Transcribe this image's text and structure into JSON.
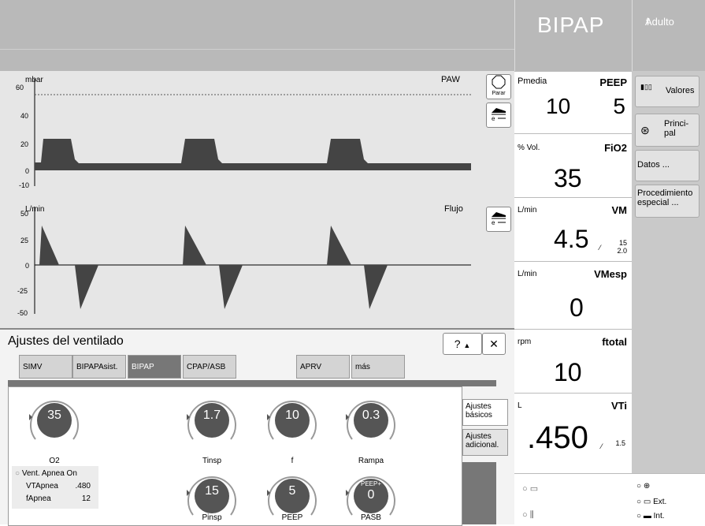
{
  "header": {
    "mode": "BIPAP",
    "patient_icon": "person-icon",
    "patient": "Adulto"
  },
  "curves": {
    "paw": {
      "unit": "mbar",
      "label": "PAW",
      "ticks": [
        "60",
        "40",
        "20",
        "0",
        "-10"
      ]
    },
    "flow": {
      "unit": "L/min",
      "label": "Flujo",
      "ticks": [
        "50",
        "25",
        "0",
        "-25",
        "-50"
      ]
    },
    "stop_label": "Parar"
  },
  "params": {
    "pmedia": {
      "label": "Pmedia",
      "value": "10"
    },
    "peep": {
      "label": "PEEP",
      "value": "5"
    },
    "fio2": {
      "unit": "% Vol.",
      "label": "FiO2",
      "value": "35"
    },
    "vm": {
      "unit": "L/min",
      "label": "VM",
      "value": "4.5",
      "alarm_hi": "15",
      "alarm_lo": "2.0"
    },
    "vmesp": {
      "unit": "L/min",
      "label": "VMesp",
      "value": "0"
    },
    "ftotal": {
      "unit": "rpm",
      "label": "ftotal",
      "value": "10"
    },
    "vti": {
      "unit": "L",
      "label": "VTi",
      "value": ".450",
      "alarm": "1.5"
    }
  },
  "right": {
    "valores": "Valores",
    "principal": "Princi- pal",
    "datos": "Datos ...",
    "procedimiento": "Procedimiento especial ...",
    "ext": "Ext.",
    "int": "Int."
  },
  "dialog": {
    "title": "Ajustes del ventilado",
    "help": "?",
    "collapse": "▲",
    "close": "✕",
    "tabs": [
      "SIMV",
      "BIPAPAsist.",
      "BIPAP",
      "CPAP/ASB",
      "APRV",
      "más"
    ],
    "side_tabs": [
      "Ajustes básicos",
      "Ajustes adicional."
    ],
    "knobs": {
      "o2": {
        "value": "35",
        "label": "O2"
      },
      "tinsp": {
        "value": "1.7",
        "label": "Tinsp"
      },
      "f": {
        "value": "10",
        "label": "f"
      },
      "rampa": {
        "value": "0.3",
        "label": "Rampa"
      },
      "pinsp": {
        "value": "15",
        "label": "Pinsp"
      },
      "peep": {
        "value": "5",
        "label": "PEEP"
      },
      "pasb": {
        "top": "PEEP+",
        "value": "0",
        "label": "PASB"
      }
    },
    "apnea": {
      "title": "Vent. Apnea On",
      "vt_label": "VTApnea",
      "vt_value": ".480",
      "f_label": "fApnea",
      "f_value": "12"
    }
  },
  "colors": {
    "header_gray": "#b9b9b9",
    "graph_bg": "#e6e6e6",
    "curve": "#444444",
    "knob_dark": "#555555"
  }
}
